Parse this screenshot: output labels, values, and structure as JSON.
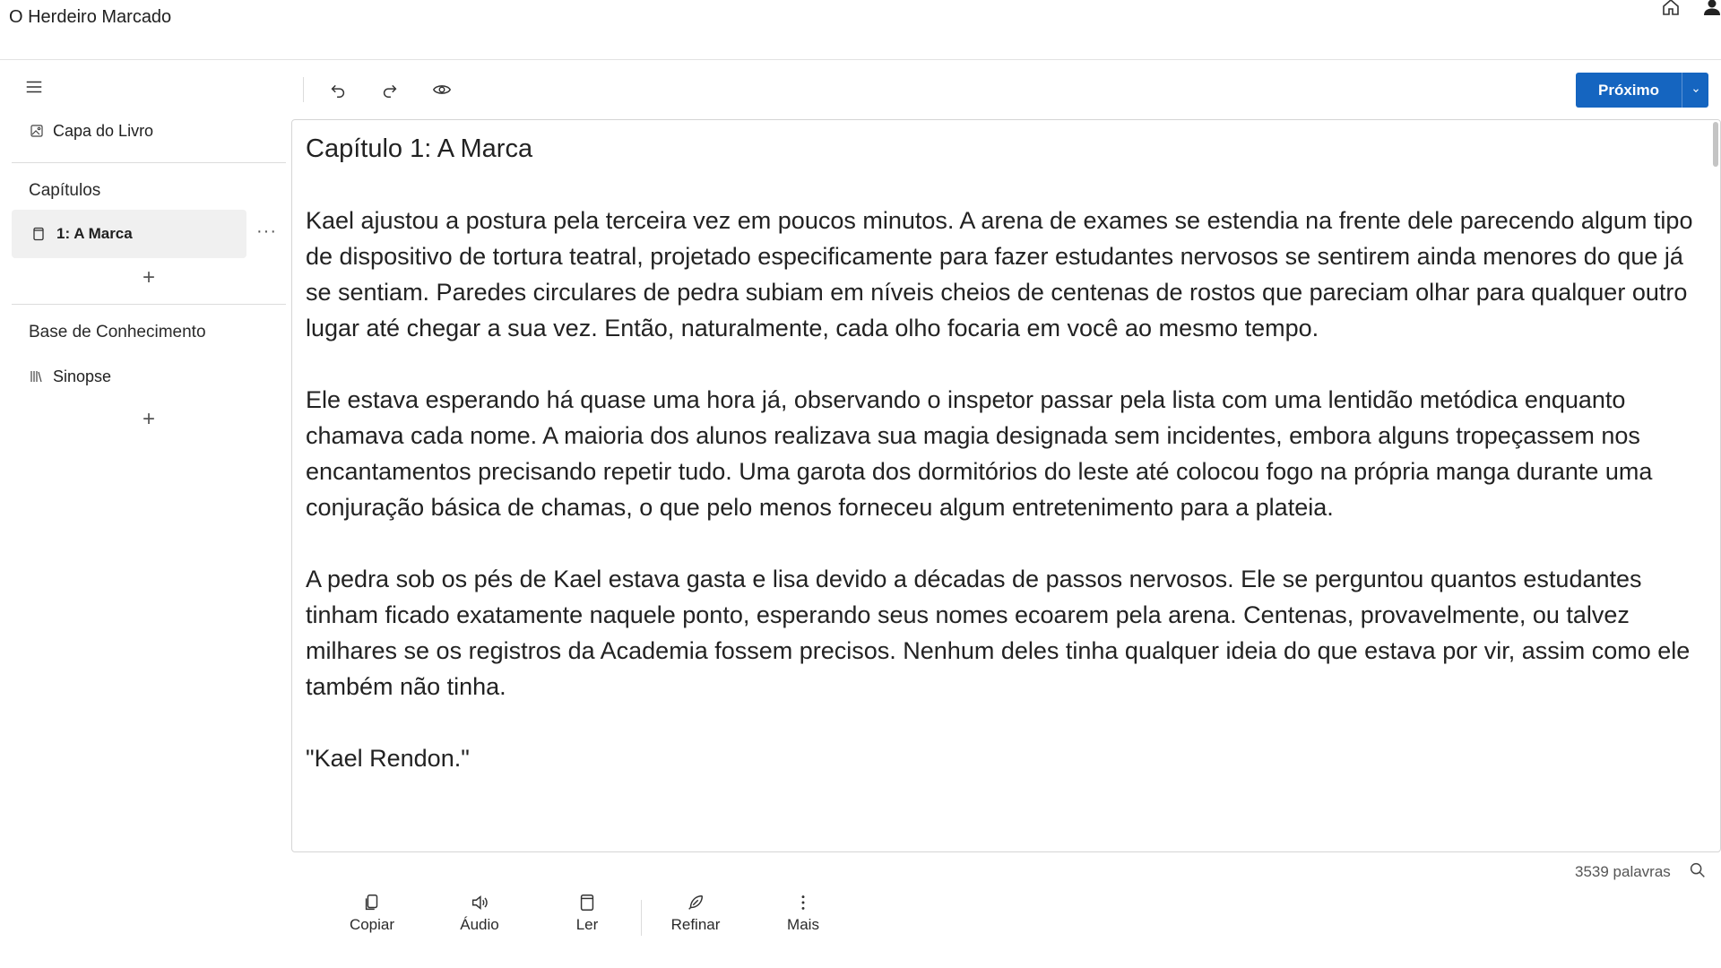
{
  "app": {
    "title": "O Herdeiro Marcado"
  },
  "topbar": {
    "icons": [
      "home-icon",
      "user-icon"
    ]
  },
  "sidebar": {
    "cover_label": "Capa do Livro",
    "chapters_title": "Capítulos",
    "chapters": [
      {
        "label": "1: A Marca"
      }
    ],
    "knowledge_title": "Base de Conhecimento",
    "knowledge_items": [
      {
        "label": "Sinopse"
      }
    ],
    "more_label": "···",
    "add_label": "+"
  },
  "toolbar": {
    "icons": [
      "undo-icon",
      "redo-icon",
      "eye-icon"
    ],
    "next_label": "Próximo"
  },
  "editor": {
    "heading": "Capítulo 1: A Marca",
    "paragraphs": [
      "Kael ajustou a postura pela terceira vez em poucos minutos. A arena de exames se estendia na frente dele parecendo algum tipo de dispositivo de tortura teatral, projetado especificamente para fazer estudantes nervosos se sentirem ainda menores do que já se sentiam. Paredes circulares de pedra subiam em níveis cheios de centenas de rostos que pareciam olhar para qualquer outro lugar até chegar a sua vez. Então, naturalmente, cada olho focaria em você ao mesmo tempo.",
      "Ele estava esperando há quase uma hora já, observando o inspetor passar pela lista com uma lentidão metódica enquanto chamava cada nome. A maioria dos alunos realizava sua magia designada sem incidentes, embora alguns tropeçassem nos encantamentos precisando repetir tudo. Uma garota dos dormitórios do leste até colocou fogo na própria manga durante uma conjuração básica de chamas, o que pelo menos forneceu algum entretenimento para a plateia.",
      "A pedra sob os pés de Kael estava gasta e lisa devido a décadas de passos nervosos. Ele se perguntou quantos estudantes tinham ficado exatamente naquele ponto, esperando seus nomes ecoarem pela arena. Centenas, provavelmente, ou talvez milhares se os registros da Academia fossem precisos. Nenhum deles tinha qualquer ideia do que estava por vir, assim como ele também não tinha.",
      "\"Kael Rendon.\""
    ]
  },
  "status": {
    "word_count": "3539 palavras"
  },
  "actions": [
    {
      "label": "Copiar",
      "icon": "copy-icon"
    },
    {
      "label": "Áudio",
      "icon": "speaker-icon"
    },
    {
      "label": "Ler",
      "icon": "book-icon"
    },
    {
      "label": "Refinar",
      "icon": "feather-icon"
    },
    {
      "label": "Mais",
      "icon": "more-vertical-icon"
    }
  ],
  "colors": {
    "accent": "#1565c0",
    "border": "#d5d5d5",
    "selected_bg": "#f0f0f0"
  }
}
